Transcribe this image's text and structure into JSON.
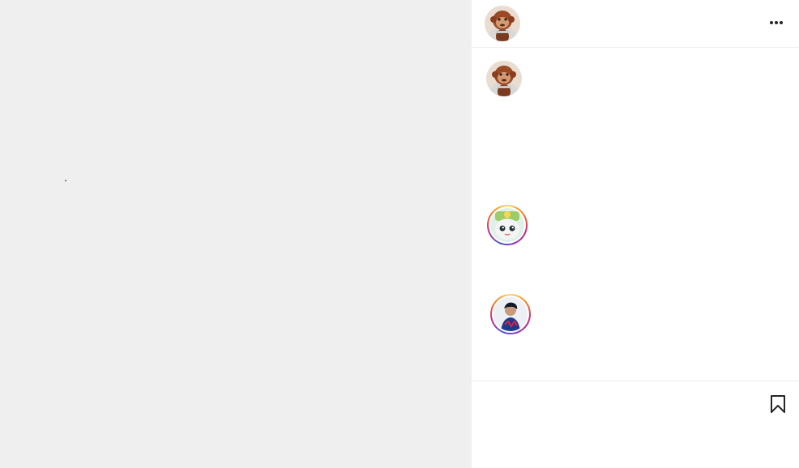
{
  "post": {
    "author_avatar_icon": "orangutan-avatar-icon"
  },
  "header": {
    "more_icon": "more-options-icon"
  },
  "comments": {
    "caption_avatar_icon": "orangutan-avatar-icon",
    "items": [
      {
        "avatar_icon": "cartoon-character-avatar-icon",
        "has_story_ring": true
      },
      {
        "avatar_icon": "person-avatar-icon",
        "has_story_ring": true
      }
    ]
  },
  "actions": {
    "save_icon": "bookmark-icon"
  },
  "colors": {
    "media_background": "#efefef",
    "divider": "#efefef",
    "icon": "#262626",
    "story_ring": [
      "#feda75",
      "#fa7e1e",
      "#d62976",
      "#962fbf",
      "#4f5bd5"
    ]
  }
}
